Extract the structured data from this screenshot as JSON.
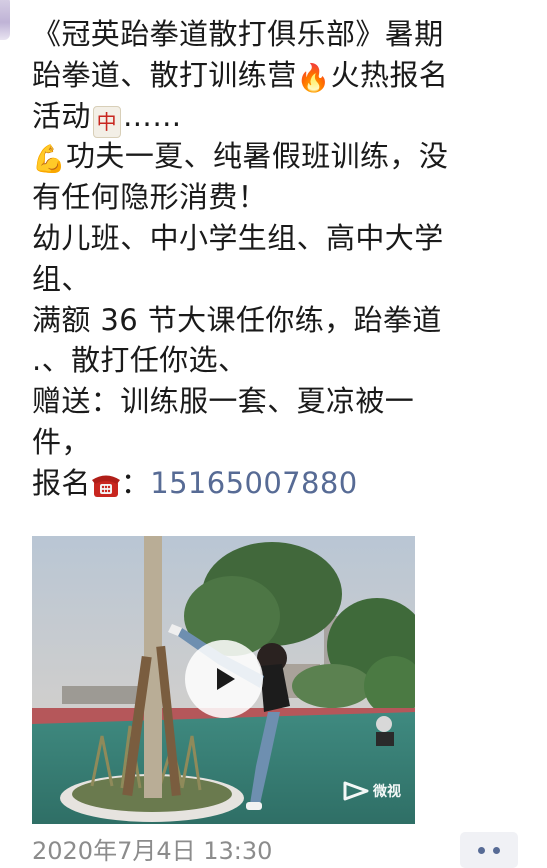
{
  "post": {
    "lines": [
      "《冠英跆拳道散打俱乐部》暑期",
      "跆拳道、散打训练营",
      "火热报名",
      "活动",
      "……",
      "功夫一夏、纯暑假班训练，没",
      "有任何隐形消费！",
      "幼儿班、中小学生组、高中大学",
      "组、",
      "满额 36 节大课任你练，跆拳道",
      ".、散打任你选、",
      "赠送：训练服一套、夏凉被一",
      "件，",
      "报名",
      "："
    ],
    "phone": "15165007880",
    "emojis": {
      "fire": "🔥",
      "mahjong_tile": "中",
      "muscle": "💪",
      "telephone": "☎"
    }
  },
  "video": {
    "watermark_text": "微视"
  },
  "footer": {
    "timestamp": "2020年7月4日 13:30"
  },
  "icons": {
    "play": "play-icon",
    "more": "more-dots-icon",
    "weishi": "weishi-logo-icon"
  },
  "colors": {
    "link": "#576b95",
    "timestamp": "#8c8c8c",
    "text": "#1a1a1a"
  }
}
